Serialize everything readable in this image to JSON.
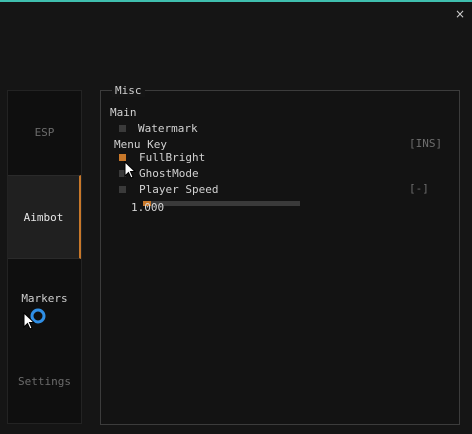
{
  "window": {
    "close_glyph": "×"
  },
  "tabs": [
    {
      "label": "ESP",
      "state": "dim"
    },
    {
      "label": "Aimbot",
      "state": "active"
    },
    {
      "label": "Markers",
      "state": "bright"
    },
    {
      "label": "Settings",
      "state": "dim"
    }
  ],
  "group": {
    "title": "Misc",
    "section": "Main",
    "watermark": {
      "label": "Watermark",
      "checked": false
    },
    "menu_key": {
      "label": "Menu Key",
      "key": "[INS]"
    },
    "fullbright": {
      "label": "FullBright",
      "checked": true
    },
    "ghostmode": {
      "label": "GhostMode",
      "checked": false
    },
    "player_speed": {
      "label": "Player Speed",
      "checked": false,
      "key": "[-]"
    },
    "speed_slider": {
      "value_text": "1.000",
      "fill_fraction": 0.05
    }
  },
  "colors": {
    "accent": "#c8782a",
    "top_bar": "#3fbfae"
  },
  "icons": [
    "close-icon",
    "mouse-pointer-icon",
    "busy-spinner-icon"
  ]
}
